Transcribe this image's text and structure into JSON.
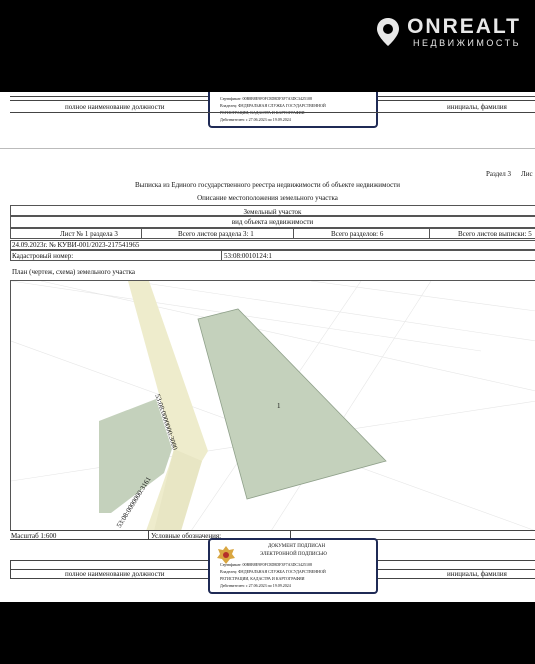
{
  "brand": {
    "name": "ONREALT",
    "tagline": "НЕДВИЖИМОСТЬ"
  },
  "sig_top": {
    "position_label": "полное наименование должности",
    "name_label": "инициалы, фамилия",
    "stamp_lines": [
      "Сертификат: 00B8B8E9F0FC8D8DF3F7A3DC3425108",
      "Владелец: ФЕДЕРАЛЬНАЯ СЛУЖБА ГОСУДАРСТВЕННОЙ",
      "РЕГИСТРАЦИИ, КАДАСТРА И КАРТОГРАФИИ",
      "Действителен: с 27.06.2023 по 19.09.2024"
    ]
  },
  "header": {
    "section": "Раздел 3",
    "sheet_short": "Лис",
    "title": "Выписка из Единого государственного реестра недвижимости об объекте недвижимости",
    "subtitle": "Описание местоположения земельного участка"
  },
  "table": {
    "object_type": "Земельный участок",
    "object_caption": "вид объекта недвижимости",
    "sheet": "Лист № 1 раздела 3",
    "sheets_total_section": "Всего листов раздела 3: 1",
    "sections_total": "Всего разделов: 6",
    "sheets_total": "Всего листов выписки: 5",
    "date_number": "24.09.2023г. № КУВИ-001/2023-217541965",
    "cadastral_label": "Кадастровый номер:",
    "cadastral_value": "53:08:0010124:1",
    "plan_label": "План (чертеж, схема) земельного участка"
  },
  "plan": {
    "road_label_1": "53:08:0000000:3080",
    "road_label_2": "53:08:0000000:3161",
    "parcel_label": "1"
  },
  "footer_row": {
    "scale": "Масштаб 1:600",
    "legend": "Условные обозначения:"
  },
  "stamp_bottom": {
    "title_1": "ДОКУМЕНТ ПОДПИСАН",
    "title_2": "ЭЛЕКТРОННОЙ ПОДПИСЬЮ",
    "lines": [
      "Сертификат: 00B8B8E9F0FC8D8DF3F7A3DC3425108",
      "Владелец: ФЕДЕРАЛЬНАЯ СЛУЖБА ГОСУДАРСТВЕННОЙ",
      "РЕГИСТРАЦИИ, КАДАСТРА И КАРТОГРАФИИ",
      "Действителен: с 27.06.2023 по 19.09.2024"
    ]
  },
  "sig_bottom": {
    "position_label": "полное наименование должности",
    "name_label": "инициалы, фамилия"
  },
  "colors": {
    "parcel": "#c4d1bc",
    "road": "#eeeccc",
    "stamp_border": "#1f2a55",
    "emblem": "#d9a640"
  }
}
